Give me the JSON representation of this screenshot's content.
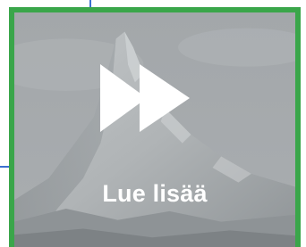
{
  "card": {
    "cta_label": "Lue lisää",
    "play_icon": "fast-forward-icon",
    "border_color": "#3aa64a",
    "overlay_tint": "#9ea3a6"
  },
  "background_image": {
    "subject": "mountain-peak"
  }
}
